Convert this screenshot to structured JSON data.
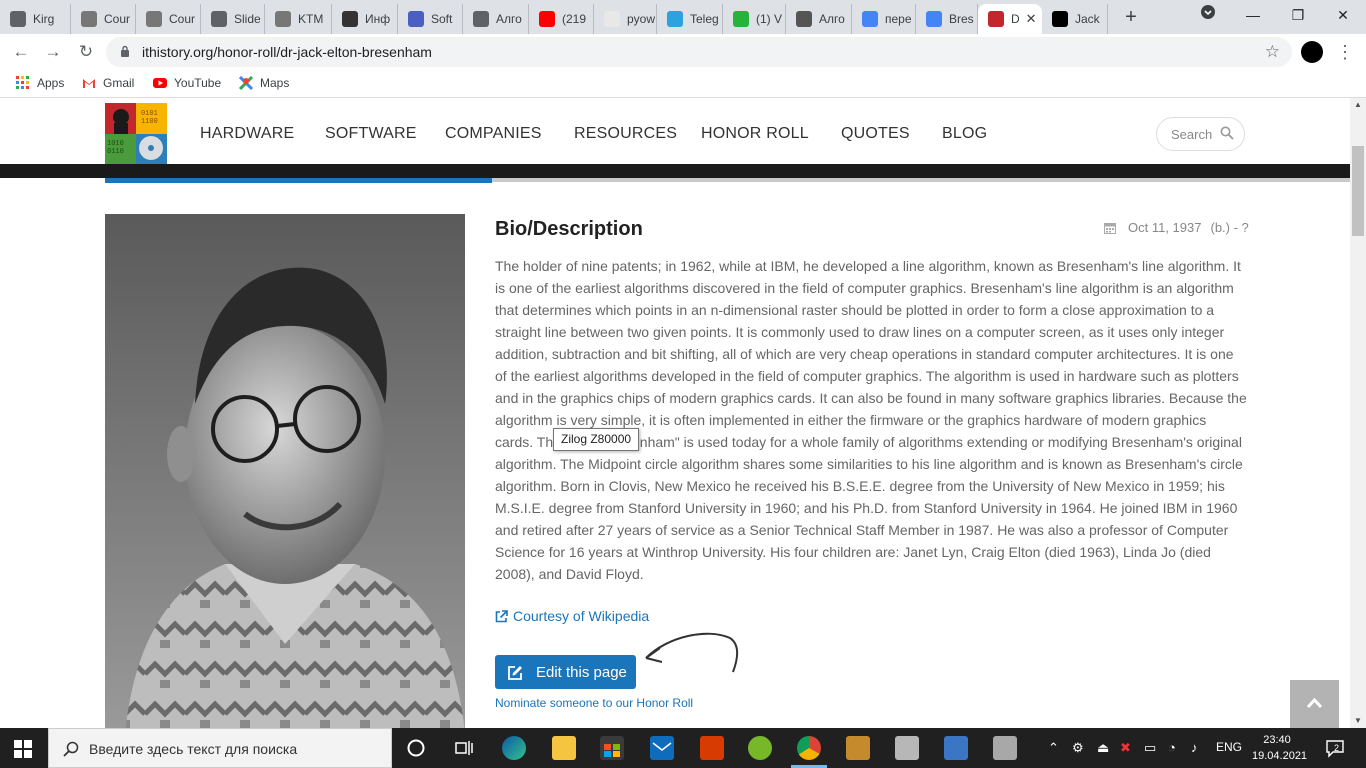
{
  "browser": {
    "tabs": [
      {
        "label": "Kirg",
        "icon": "globe-icon",
        "color": "#5f6368"
      },
      {
        "label": "Cour",
        "icon": "pdf-doc-icon",
        "color": "#777777"
      },
      {
        "label": "Cour",
        "icon": "pdf-doc-icon",
        "color": "#777777"
      },
      {
        "label": "Slide",
        "icon": "globe-icon",
        "color": "#5f6368"
      },
      {
        "label": "KTM",
        "icon": "pdf-doc-icon",
        "color": "#777777"
      },
      {
        "label": "Инф",
        "icon": "video-icon",
        "color": "#333333"
      },
      {
        "label": "Soft",
        "icon": "cube-icon",
        "color": "#4a5fc1"
      },
      {
        "label": "Алго",
        "icon": "globe-icon",
        "color": "#5f6368"
      },
      {
        "label": "(219",
        "icon": "youtube-icon",
        "color": "#ff0000"
      },
      {
        "label": "pyow",
        "icon": "blank-doc-icon",
        "color": "#e8e8e8"
      },
      {
        "label": "Teleg",
        "icon": "telegram-icon",
        "color": "#2aa3df"
      },
      {
        "label": "(1) V",
        "icon": "whatsapp-icon",
        "color": "#25b33a"
      },
      {
        "label": "Алго",
        "icon": "chart-icon",
        "color": "#555555"
      },
      {
        "label": "пере",
        "icon": "google-icon",
        "color": "#4285f4"
      },
      {
        "label": "Bres",
        "icon": "google-icon",
        "color": "#4285f4"
      },
      {
        "label": "D",
        "icon": "ithistory-icon",
        "color": "#c1272d",
        "active": true
      },
      {
        "label": "Jack",
        "icon": "font-a-icon",
        "color": "#000000"
      }
    ],
    "url": "ithistory.org/honor-roll/dr-jack-elton-bresenham",
    "bookmarks": [
      {
        "label": "Apps",
        "icon": "apps-grid-icon"
      },
      {
        "label": "Gmail",
        "icon": "gmail-icon"
      },
      {
        "label": "YouTube",
        "icon": "youtube-icon"
      },
      {
        "label": "Maps",
        "icon": "maps-icon"
      }
    ]
  },
  "site": {
    "nav": [
      "HARDWARE",
      "SOFTWARE",
      "COMPANIES",
      "RESOURCES",
      "HONOR ROLL",
      "QUOTES",
      "BLOG"
    ],
    "search_placeholder": "Search",
    "accent": "#1b75bb"
  },
  "profile": {
    "heading": "Bio/Description",
    "date": "Oct 11, 1937",
    "lifespan": "(b.) - ?",
    "bio": "The holder of nine patents; in 1962, while at IBM, he developed a line algorithm, known as Bresenham's line algorithm. It is one of the earliest algorithms discovered in the field of computer graphics. Bresenham's line algorithm is an algorithm that determines which points in an n-dimensional raster should be plotted in order to form a close approximation to a straight line between two given points. It is commonly used to draw lines on a computer screen, as it uses only integer addition, subtraction and bit shifting, all of which are very cheap operations in standard computer architectures. It is one of the earliest algorithms developed in the field of computer graphics. The algorithm is used in hardware such as plotters and in the graphics chips of modern graphics cards. It can also be found in many software graphics libraries. Because the algorithm is very simple, it is often implemented in either the firmware or the graphics hardware of modern graphics cards. The label \"Bresenham\" is used today for a whole family of algorithms extending or modifying Bresenham's original algorithm. The Midpoint circle algorithm shares some similarities to his line algorithm and is known as Bresenham's circle algorithm. Born in Clovis, New Mexico he received his B.S.E.E. degree from the University of New Mexico in 1959; his M.S.I.E. degree from Stanford University in 1960; and his Ph.D. from Stanford University in 1964. He joined IBM in 1960 and retired after 27 years of service as a Senior Technical Staff Member in 1987. He was also a professor of Computer Science for 16 years at Winthrop University. His four children are: Janet Lyn, Craig Elton (died 1963), Linda Jo (died 2008), and David Floyd.",
    "courtesy": "Courtesy of Wikipedia",
    "edit_label": "Edit this page",
    "nominate": "Nominate someone to our Honor Roll",
    "tooltip": "Zilog Z80000"
  },
  "taskbar": {
    "search_placeholder": "Введите здесь текст для поиска",
    "language": "ENG",
    "time": "23:40",
    "date": "19.04.2021",
    "notification_count": "2"
  }
}
